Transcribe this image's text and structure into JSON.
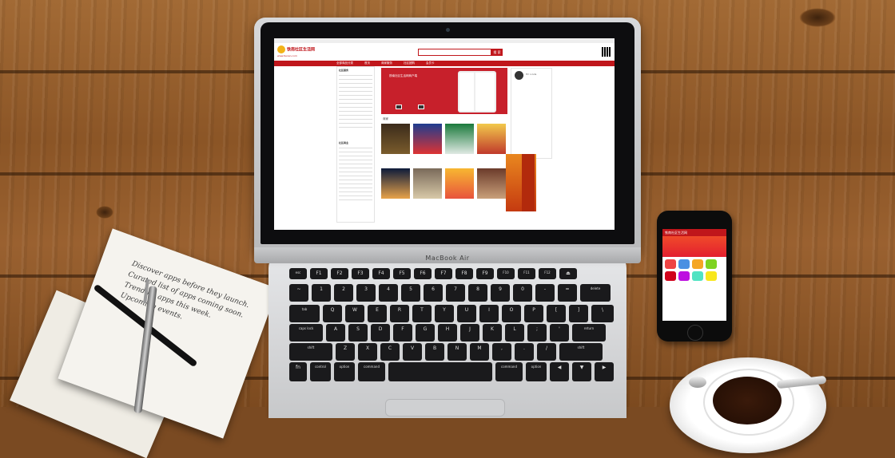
{
  "scene": {
    "laptop": {
      "model": "MacBook Air",
      "website": {
        "logo_text": "铁南社区生活网",
        "logo_url_text": "www.tienan.com",
        "search_button": "搜 索",
        "nav": [
          "全部商品分类",
          "首页",
          "商家服务",
          "社区团购",
          "会员卡"
        ],
        "banner_title": "铁南社区生活网商户端",
        "sidebar_title": "社区服务",
        "sidebar_title_2": "社区商业",
        "profile_greeting": "Hi! Linda",
        "section_label": "商家"
      },
      "keyboard_rows": [
        [
          "esc",
          "F1",
          "F2",
          "F3",
          "F4",
          "F5",
          "F6",
          "F7",
          "F8",
          "F9",
          "F10",
          "F11",
          "F12",
          "⏏"
        ],
        [
          "~",
          "1",
          "2",
          "3",
          "4",
          "5",
          "6",
          "7",
          "8",
          "9",
          "0",
          "-",
          "=",
          "delete"
        ],
        [
          "tab",
          "Q",
          "W",
          "E",
          "R",
          "T",
          "Y",
          "U",
          "I",
          "O",
          "P",
          "[",
          "]",
          "\\"
        ],
        [
          "caps lock",
          "A",
          "S",
          "D",
          "F",
          "G",
          "H",
          "J",
          "K",
          "L",
          ";",
          "'",
          "return"
        ],
        [
          "shift",
          "Z",
          "X",
          "C",
          "V",
          "B",
          "N",
          "M",
          ",",
          ".",
          "/",
          "shift"
        ],
        [
          "fn",
          "control",
          "option",
          "command",
          "",
          "command",
          "option",
          "◀",
          "▼",
          "▶"
        ]
      ]
    },
    "notebook": {
      "lines": [
        "Discover apps before they launch.",
        "Curated list of apps coming soon.",
        "Trending apps this week.",
        "Upcoming events."
      ]
    },
    "phone": {
      "app_title": "铁南社区生活网"
    }
  }
}
